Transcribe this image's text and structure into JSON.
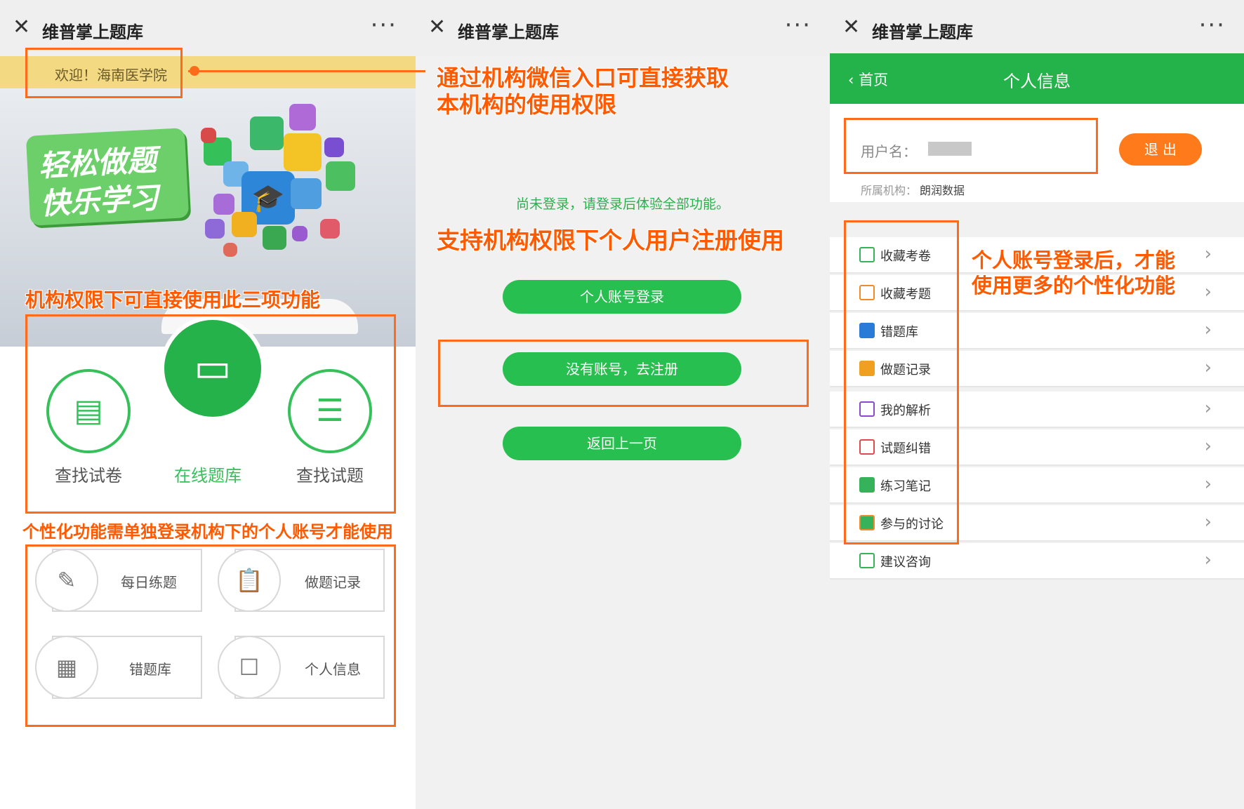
{
  "app_title": "维普掌上题库",
  "more_icon": "···",
  "close_icon": "✕",
  "accent": "#25b24a",
  "annotation_color": "#ff5a00",
  "panel1": {
    "welcome": "欢迎！海南医学院",
    "slogan_line1": "轻松做题",
    "slogan_line2": "快乐学习",
    "features": [
      {
        "label": "查找试卷",
        "icon": "exam-paper-icon"
      },
      {
        "label": "在线题库",
        "icon": "monitor-icon"
      },
      {
        "label": "查找试题",
        "icon": "list-icon"
      }
    ],
    "cards": [
      {
        "label": "每日练题",
        "icon": "edit-icon"
      },
      {
        "label": "做题记录",
        "icon": "clipboard-icon"
      },
      {
        "label": "错题库",
        "icon": "document-icon"
      },
      {
        "label": "个人信息",
        "icon": "contact-book-icon"
      }
    ]
  },
  "panel2": {
    "not_logged_in": "尚未登录，请登录后体验全部功能。",
    "login_button": "个人账号登录",
    "register_button": "没有账号，去注册",
    "back_button": "返回上一页"
  },
  "panel3": {
    "back_label": "首页",
    "header_title": "个人信息",
    "username_label": "用户名：",
    "username_value": "",
    "logout_button": "退 出",
    "org_label": "所属机构：",
    "org_value": "朗润数据",
    "menu": [
      {
        "label": "收藏考卷"
      },
      {
        "label": "收藏考题"
      },
      {
        "label": "错题库"
      },
      {
        "label": "做题记录"
      },
      {
        "label": "我的解析"
      },
      {
        "label": "试题纠错"
      },
      {
        "label": "练习笔记"
      },
      {
        "label": "参与的讨论"
      },
      {
        "label": "建议咨询"
      }
    ]
  },
  "annotations": {
    "a1": "通过机构微信入口可直接获取",
    "a1b": "本机构的使用权限",
    "a2": "机构权限下可直接使用此三项功能",
    "a3": "个性化功能需单独登录机构下的个人账号才能使用",
    "a4": "支持机构权限下个人用户注册使用",
    "a5": "个人账号登录后，才能",
    "a5b": "使用更多的个性化功能"
  }
}
